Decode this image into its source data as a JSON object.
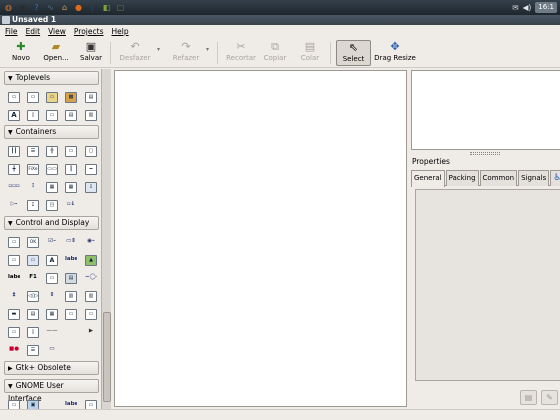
{
  "panel": {
    "launchers": [
      {
        "icon": "ubuntu-logo-icon",
        "glyph": "◍",
        "color": "#d97a2b"
      },
      {
        "icon": "terminal-icon",
        "glyph": "▣",
        "color": "#2b2b2b"
      },
      {
        "icon": "help-icon",
        "glyph": "?",
        "color": "#3b6fb5"
      },
      {
        "icon": "system-monitor-icon",
        "glyph": "∿",
        "color": "#5a6b7a"
      },
      {
        "icon": "home-folder-icon",
        "glyph": "⌂",
        "color": "#c9a24a"
      },
      {
        "icon": "firefox-icon",
        "glyph": "●",
        "color": "#e06a1b"
      },
      {
        "icon": "separator-icon",
        "glyph": "|",
        "color": "#34404b"
      },
      {
        "icon": "glade-icon",
        "glyph": "◧",
        "color": "#7aa33a"
      },
      {
        "icon": "glade-window-icon",
        "glyph": "▢",
        "color": "#6a7f3a"
      }
    ],
    "clock": "16:1"
  },
  "window": {
    "title": "Unsaved 1"
  },
  "menu": [
    "File",
    "Edit",
    "View",
    "Projects",
    "Help"
  ],
  "toolbar": {
    "novo": "Novo",
    "open": "Open...",
    "salvar": "Salvar",
    "desfazer": "Desfazer",
    "refazer": "Refazer",
    "recortar": "Recortar",
    "copiar": "Copiar",
    "colar": "Colar",
    "select": "Select",
    "drag_resize": "Drag Resize"
  },
  "palette": {
    "groups": [
      {
        "label": "Toplevels"
      },
      {
        "label": "Containers"
      },
      {
        "label": "Control and Display"
      },
      {
        "label": "Gtk+ Obsolete"
      },
      {
        "label": "GNOME User Interface"
      }
    ],
    "icon_texts": {
      "a": "A",
      "fixed": "FiXe",
      "ok": "OK",
      "label": "label",
      "label2": "label",
      "f1": "F1"
    }
  },
  "inspector": {
    "properties_label": "Properties",
    "tabs": [
      "General",
      "Packing",
      "Common",
      "Signals"
    ],
    "accessibility_icon": "accessibility-icon"
  },
  "colors": {
    "panel": "#2a333b",
    "accent": "#7aa33a"
  }
}
